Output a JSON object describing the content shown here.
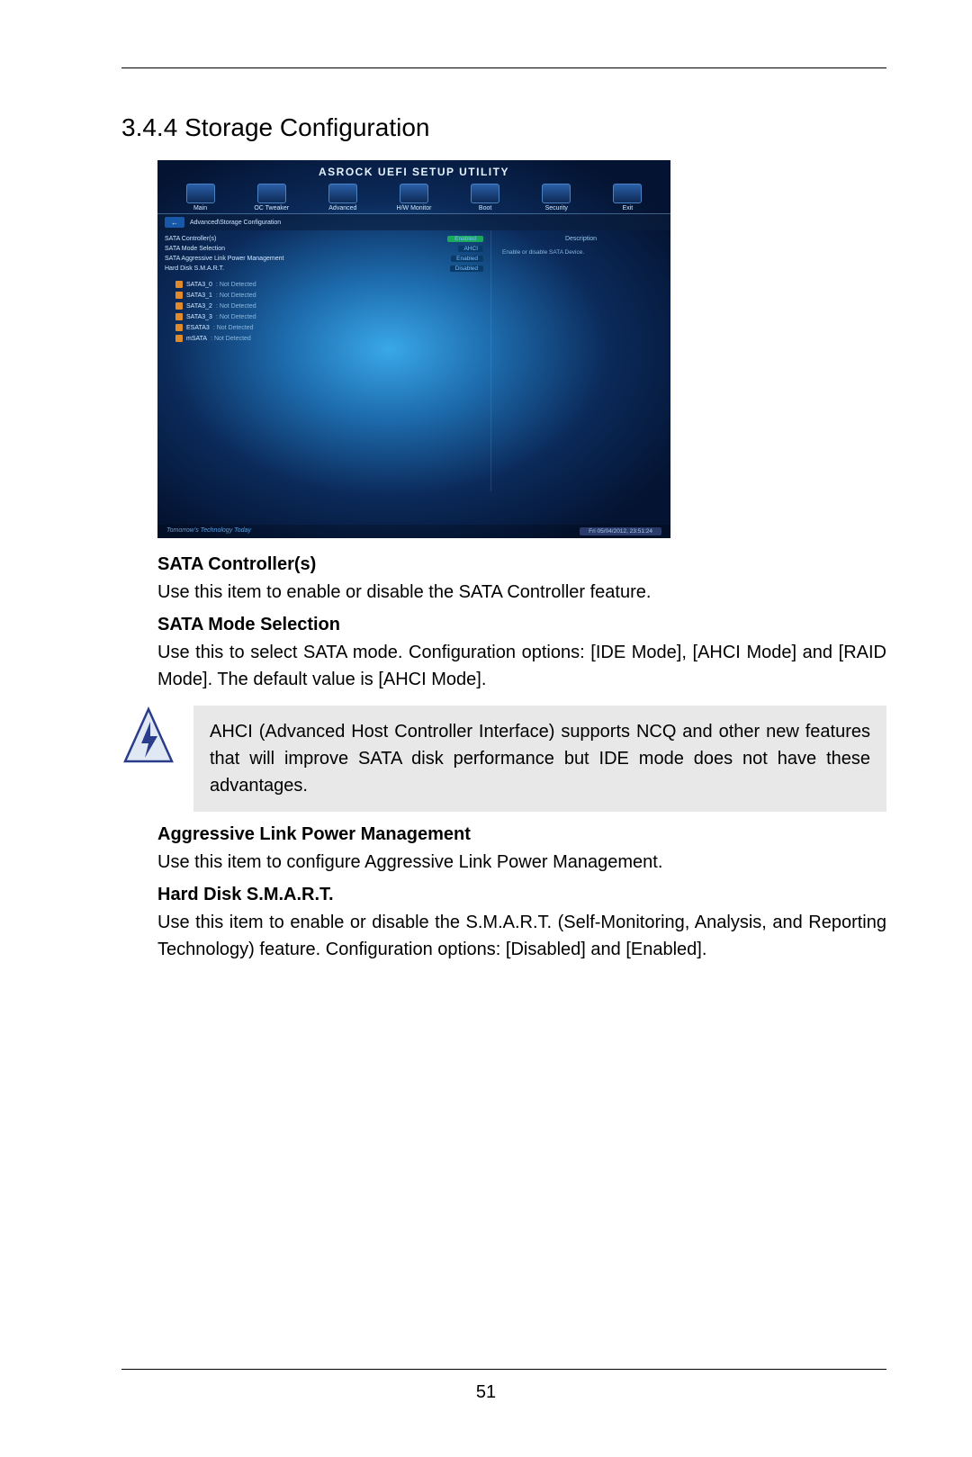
{
  "section": {
    "number": "3.4.4",
    "title": "Storage Configuration"
  },
  "bios": {
    "title": "ASROCK UEFI SETUP UTILITY",
    "tabs": [
      "Main",
      "OC Tweaker",
      "Advanced",
      "H/W Monitor",
      "Boot",
      "Security",
      "Exit"
    ],
    "breadcrumb": "Advanced\\Storage Configuration",
    "options": [
      {
        "label": "SATA Controller(s)",
        "value": "Enabled",
        "highlight": true
      },
      {
        "label": "SATA Mode Selection",
        "value": "AHCI"
      },
      {
        "label": "SATA Aggressive Link Power Management",
        "value": "Enabled"
      },
      {
        "label": "Hard Disk S.M.A.R.T.",
        "value": "Disabled"
      }
    ],
    "drives": [
      {
        "name": "SATA3_0",
        "status": ": Not Detected"
      },
      {
        "name": "SATA3_1",
        "status": ": Not Detected"
      },
      {
        "name": "SATA3_2",
        "status": ": Not Detected"
      },
      {
        "name": "SATA3_3",
        "status": ": Not Detected"
      },
      {
        "name": "ESATA3",
        "status": ": Not Detected"
      },
      {
        "name": "mSATA",
        "status": ": Not Detected"
      }
    ],
    "desc_title": "Description",
    "desc_text": "Enable or disable SATA Device.",
    "tagline": "Tomorrow's Technology Today",
    "datetime": "Fri 05/04/2012, 23:51:24"
  },
  "items": [
    {
      "title": "SATA Controller(s)",
      "body": "Use this item to enable or disable the SATA Controller feature."
    },
    {
      "title": "SATA Mode Selection",
      "body": "Use this to select SATA mode. Configuration options: [IDE Mode], [AHCI Mode] and [RAID Mode]. The default value is [AHCI Mode]."
    }
  ],
  "note": "AHCI (Advanced Host Controller Interface) supports NCQ and other new features that will improve SATA disk performance but IDE mode does not have these advantages.",
  "items2": [
    {
      "title": "Aggressive Link Power Management",
      "body": "Use this item to configure Aggressive Link Power Management."
    },
    {
      "title": "Hard Disk S.M.A.R.T.",
      "body": "Use this item to enable or disable the S.M.A.R.T. (Self-Monitoring, Analysis, and Reporting Technology) feature. Configuration options: [Disabled] and [Enabled]."
    }
  ],
  "page_number": "51"
}
